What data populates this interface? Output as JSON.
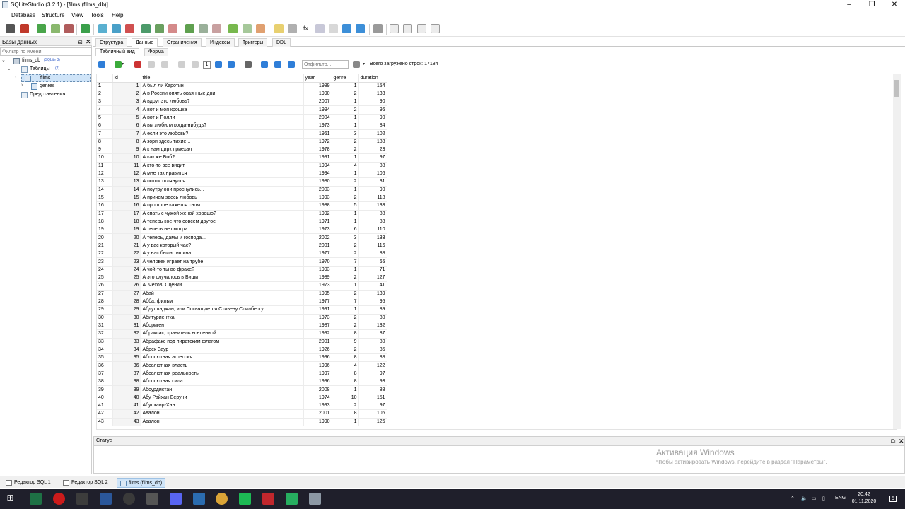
{
  "window": {
    "title": "SQLiteStudio (3.2.1) - [films (films_db)]",
    "minimize": "–",
    "maximize": "❐",
    "close": "✕"
  },
  "menu": [
    "Database",
    "Structure",
    "View",
    "Tools",
    "Help"
  ],
  "left_panel": {
    "title": "Базы данных",
    "filter_placeholder": "Фильтр по имени",
    "db_name": "films_db",
    "db_version": "(SQLite 3)",
    "tables_label": "Таблицы",
    "tables_count": "(2)",
    "tables": [
      "films",
      "genres"
    ],
    "views_label": "Представления"
  },
  "tabs": [
    "Структура",
    "Данные",
    "Ограничения",
    "Индексы",
    "Триггеры",
    "DDL"
  ],
  "active_tab": "Данные",
  "subtabs": [
    "Табличный вид",
    "Форма"
  ],
  "page_number": "1",
  "filter_placeholder": "Отфильтр...",
  "row_count": "Всего загружено строк: 17184",
  "grid": {
    "columns": [
      "id",
      "title",
      "year",
      "genre",
      "duration"
    ],
    "rows": [
      [
        1,
        "А был ли Каротин",
        1989,
        1,
        154
      ],
      [
        2,
        "А в России опять окаянные дни",
        1990,
        2,
        133
      ],
      [
        3,
        "А вдруг это любовь?",
        2007,
        1,
        90
      ],
      [
        4,
        "А вот и моя крошка",
        1994,
        2,
        96
      ],
      [
        5,
        "А вот и Полли",
        2004,
        1,
        90
      ],
      [
        6,
        "А вы любили когда-нибудь?",
        1973,
        1,
        84
      ],
      [
        7,
        "А если это любовь?",
        1961,
        3,
        102
      ],
      [
        8,
        "А зори здесь тихие...",
        1972,
        2,
        188
      ],
      [
        9,
        "А к нам цирк приехал",
        1978,
        2,
        23
      ],
      [
        10,
        "А как же Боб?",
        1991,
        1,
        97
      ],
      [
        11,
        "А кто-то все видит",
        1994,
        4,
        88
      ],
      [
        12,
        "А мне так нравится",
        1994,
        1,
        106
      ],
      [
        13,
        "А потом оглянулся...",
        1980,
        2,
        31
      ],
      [
        14,
        "А поутру они проснулись...",
        2003,
        1,
        90
      ],
      [
        15,
        "А причем здесь любовь",
        1993,
        2,
        118
      ],
      [
        16,
        "А прошлое кажется сном",
        1988,
        5,
        133
      ],
      [
        17,
        "А спать с чужой женой хорошо?",
        1992,
        1,
        88
      ],
      [
        18,
        "А теперь кое-что совсем другое",
        1971,
        1,
        88
      ],
      [
        19,
        "А теперь не смотри",
        1973,
        6,
        110
      ],
      [
        20,
        "А теперь, дамы и господа...",
        2002,
        3,
        133
      ],
      [
        21,
        "А у вас который час?",
        2001,
        2,
        116
      ],
      [
        22,
        "А у нас была тишина",
        1977,
        2,
        88
      ],
      [
        23,
        "А человек играет на трубе",
        1970,
        7,
        65
      ],
      [
        24,
        "А чой-то ты во фраке?",
        1993,
        1,
        71
      ],
      [
        25,
        "А это случилось в Виши",
        1989,
        2,
        127
      ],
      [
        26,
        "А. Чехов. Сценки",
        1973,
        1,
        41
      ],
      [
        27,
        "Абай",
        1995,
        2,
        139
      ],
      [
        28,
        "Абба: фильм",
        1977,
        7,
        95
      ],
      [
        29,
        "Абдулладжан, или Посвящается Стивену Спилбергу",
        1991,
        1,
        89
      ],
      [
        30,
        "Абитуриентка",
        1973,
        2,
        80
      ],
      [
        31,
        "Абориген",
        1987,
        2,
        132
      ],
      [
        32,
        "Абраксас, хранитель вселенной",
        1992,
        8,
        87
      ],
      [
        33,
        "Абрафакс под пиратским флагом",
        2001,
        9,
        80
      ],
      [
        34,
        "Абрек Заур",
        1926,
        2,
        85
      ],
      [
        35,
        "Абсолютная агрессия",
        1996,
        8,
        88
      ],
      [
        36,
        "Абсолютная власть",
        1996,
        4,
        122
      ],
      [
        37,
        "Абсолютная реальность",
        1997,
        8,
        97
      ],
      [
        38,
        "Абсолютная сила",
        1996,
        8,
        93
      ],
      [
        39,
        "Абсурдистан",
        2008,
        1,
        88
      ],
      [
        40,
        "Абу Райхан Беруни",
        1974,
        10,
        151
      ],
      [
        41,
        "Абулхаир-Хан",
        1993,
        2,
        97
      ],
      [
        42,
        "Авалон",
        2001,
        8,
        106
      ],
      [
        43,
        "Авалон",
        1990,
        1,
        126
      ]
    ]
  },
  "status": {
    "title": "Статус",
    "watermark_title": "Активация Windows",
    "watermark_text": "Чтобы активировать Windows, перейдите в раздел \"Параметры\"."
  },
  "bottom_tabs": [
    "Редактор SQL 1",
    "Редактор SQL 2",
    "films (films_db)"
  ],
  "taskbar": {
    "lang": "ENG",
    "time": "20:42",
    "date": "01.11.2020",
    "notify_count": "5"
  },
  "colors": {
    "accent": "#2f7ed8",
    "selection": "#cfe4f8",
    "taskbar": "#1f1f2b"
  }
}
